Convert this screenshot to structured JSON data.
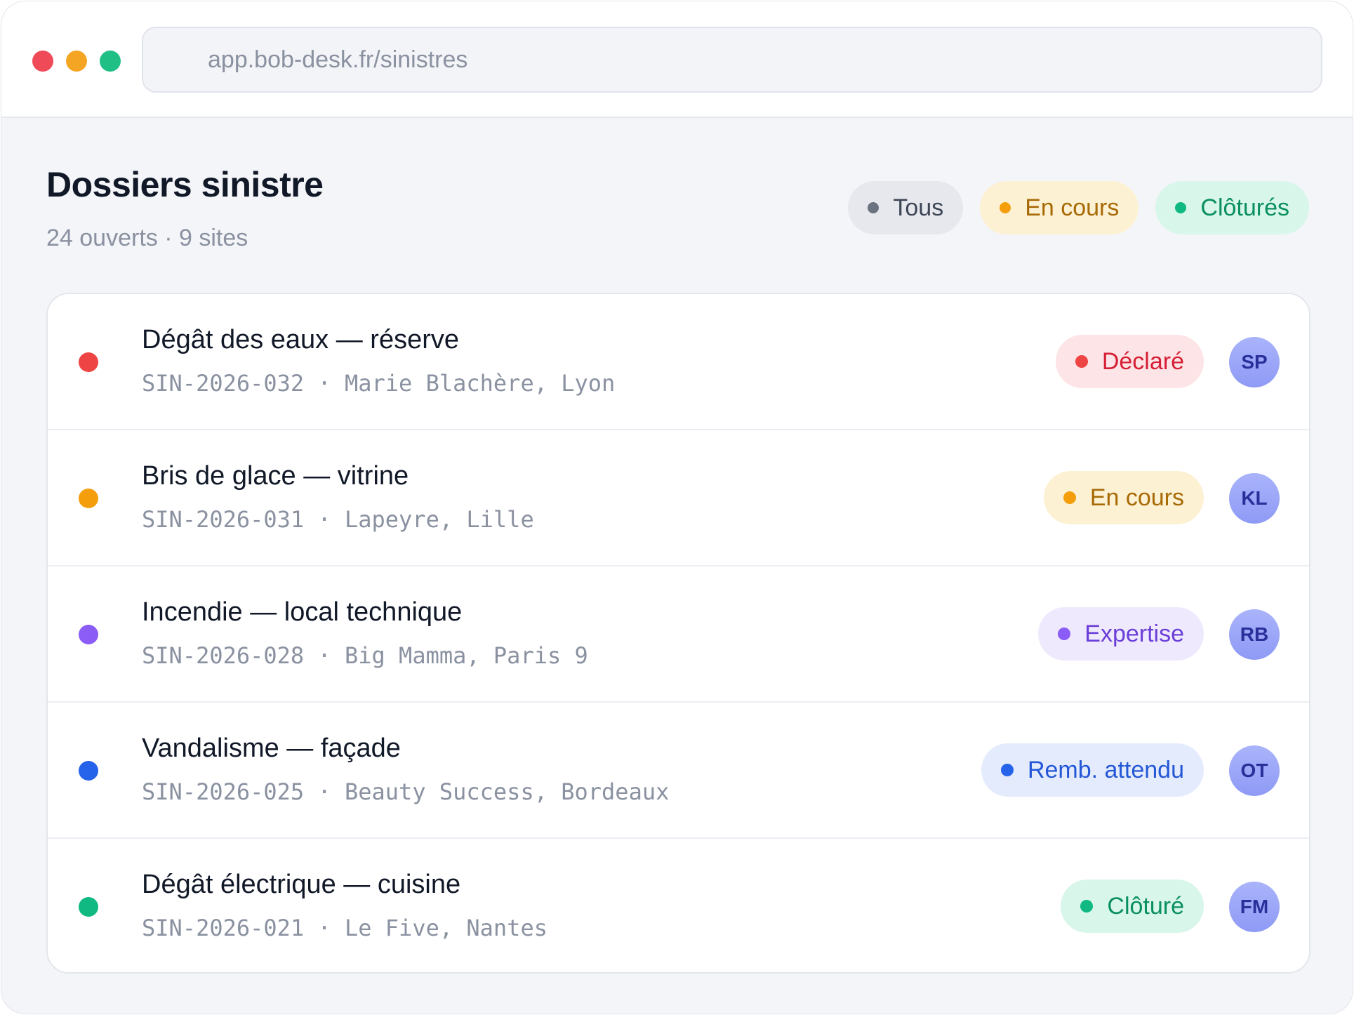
{
  "window": {
    "traffic_lights": [
      {
        "name": "close",
        "color": "#ef4a58"
      },
      {
        "name": "minimize",
        "color": "#f5a524"
      },
      {
        "name": "zoom",
        "color": "#1fbf85"
      }
    ],
    "url": "app.bob-desk.fr/sinistres"
  },
  "header": {
    "title": "Dossiers sinistre",
    "subtitle": "24 ouverts · 9 sites"
  },
  "filters": [
    {
      "label": "Tous",
      "bg": "#e6e8ee",
      "fg": "#3f4656",
      "dot": "#6b7280"
    },
    {
      "label": "En cours",
      "bg": "#fdf1d4",
      "fg": "#a76a06",
      "dot": "#f59e0b"
    },
    {
      "label": "Clôturés",
      "bg": "#d8f6ea",
      "fg": "#0a8f5e",
      "dot": "#10b981"
    }
  ],
  "claims": [
    {
      "title": "Dégât des eaux — réserve",
      "meta": "SIN-2026-032 · Marie Blachère, Lyon",
      "dot": "#ef4444",
      "status": {
        "label": "Déclaré",
        "bg": "#fde4e6",
        "fg": "#d51f35",
        "dot": "#ef4444"
      },
      "avatar": "SP"
    },
    {
      "title": "Bris de glace — vitrine",
      "meta": "SIN-2026-031 · Lapeyre, Lille",
      "dot": "#f59e0b",
      "status": {
        "label": "En cours",
        "bg": "#fdf1d4",
        "fg": "#a76a06",
        "dot": "#f59e0b"
      },
      "avatar": "KL"
    },
    {
      "title": "Incendie — local technique",
      "meta": "SIN-2026-028 · Big Mamma, Paris 9",
      "dot": "#8b5cf6",
      "status": {
        "label": "Expertise",
        "bg": "#efe9fd",
        "fg": "#6a3fd8",
        "dot": "#8b5cf6"
      },
      "avatar": "RB"
    },
    {
      "title": "Vandalisme — façade",
      "meta": "SIN-2026-025 · Beauty Success, Bordeaux",
      "dot": "#2563eb",
      "status": {
        "label": "Remb. attendu",
        "bg": "#e4ebfd",
        "fg": "#2457d6",
        "dot": "#2563eb"
      },
      "avatar": "OT"
    },
    {
      "title": "Dégât électrique — cuisine",
      "meta": "SIN-2026-021 · Le Five, Nantes",
      "dot": "#10b981",
      "status": {
        "label": "Clôturé",
        "bg": "#d8f6ea",
        "fg": "#0a8f5e",
        "dot": "#10b981"
      },
      "avatar": "FM"
    }
  ]
}
